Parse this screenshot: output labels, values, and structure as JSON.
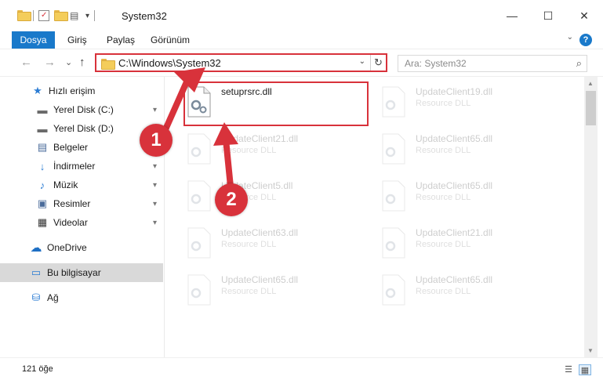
{
  "window": {
    "title": "System32",
    "minimize_icon": "—",
    "maximize_icon": "☐",
    "close_icon": "✕"
  },
  "ribbon": {
    "tabs": [
      "Dosya",
      "Giriş",
      "Paylaş",
      "Görünüm"
    ],
    "help_icon": "?",
    "collapse_icon": "⌄"
  },
  "navbar": {
    "back_icon": "←",
    "forward_icon": "→",
    "recent_icon": "⌄",
    "up_icon": "↑",
    "address": "C:\\Windows\\System32",
    "address_drop_icon": "⌄",
    "refresh_icon": "↻",
    "search_placeholder": "Ara: System32",
    "search_icon": "⌕"
  },
  "sidebar": {
    "items": [
      {
        "label": "Hızlı erişim",
        "icon": "★",
        "pinned": false
      },
      {
        "label": "Yerel Disk (C:)",
        "icon": "▬",
        "pinned": true
      },
      {
        "label": "Yerel Disk (D:)",
        "icon": "▬",
        "pinned": false
      },
      {
        "label": "Belgeler",
        "icon": "▤",
        "pinned": false
      },
      {
        "label": "İndirmeler",
        "icon": "↓",
        "pinned": true
      },
      {
        "label": "Müzik",
        "icon": "♪",
        "pinned": true
      },
      {
        "label": "Resimler",
        "icon": "▣",
        "pinned": true
      },
      {
        "label": "Videolar",
        "icon": "▦",
        "pinned": true
      },
      {
        "label": "OneDrive",
        "icon": "☁",
        "pinned": false
      },
      {
        "label": "Bu bilgisayar",
        "icon": "▭",
        "pinned": false,
        "selected": true
      },
      {
        "label": "Ağ",
        "icon": "⛁",
        "pinned": false
      }
    ],
    "pin_icon": "📌"
  },
  "files": {
    "left": [
      {
        "name": "setuprsrc.dll",
        "type": ""
      },
      {
        "name": "UpdateClient21.dll",
        "type": "Resource DLL"
      },
      {
        "name": "UpdateClient5.dll",
        "type": "Resource DLL"
      },
      {
        "name": "UpdateClient63.dll",
        "type": "Resource DLL"
      },
      {
        "name": "UpdateClient65.dll",
        "type": "Resource DLL"
      }
    ],
    "right": [
      {
        "name": "UpdateClient19.dll",
        "type": "Resource DLL"
      },
      {
        "name": "UpdateClient65.dll",
        "type": "Resource DLL"
      },
      {
        "name": "UpdateClient65.dll",
        "type": "Resource DLL"
      },
      {
        "name": "UpdateClient21.dll",
        "type": "Resource DLL"
      },
      {
        "name": "UpdateClient65.dll",
        "type": "Resource DLL"
      }
    ]
  },
  "annotations": {
    "badge1": "1",
    "badge2": "2",
    "accent": "#d8323b"
  },
  "status": {
    "count": "121 öğe",
    "details_icon": "☰",
    "tiles_icon": "▦"
  }
}
